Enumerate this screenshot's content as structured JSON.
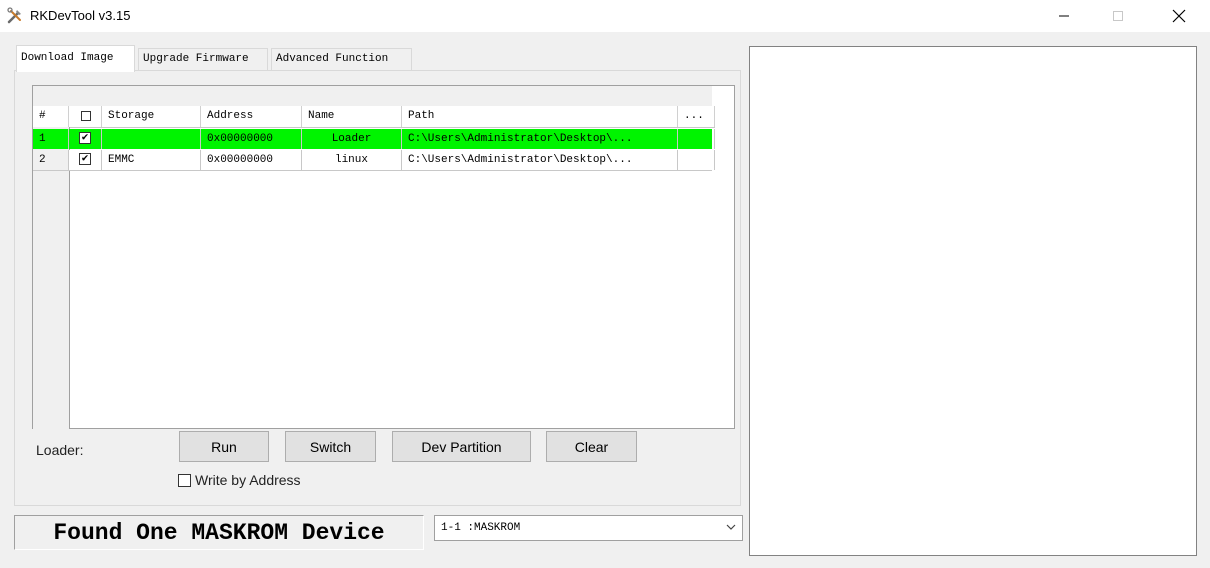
{
  "window": {
    "title": "RKDevTool v3.15"
  },
  "tabs": [
    {
      "label": "Download Image"
    },
    {
      "label": "Upgrade Firmware"
    },
    {
      "label": "Advanced Function"
    }
  ],
  "table": {
    "columns": [
      "#",
      "Storage",
      "Address",
      "Name",
      "Path",
      "..."
    ],
    "rows": [
      {
        "index": "1",
        "checked": "✔",
        "storage": "",
        "address": "0x00000000",
        "name": "Loader",
        "path": "C:\\Users\\Administrator\\Desktop\\..."
      },
      {
        "index": "2",
        "checked": "✔",
        "storage": "EMMC",
        "address": "0x00000000",
        "name": "linux",
        "path": "C:\\Users\\Administrator\\Desktop\\..."
      }
    ]
  },
  "loader_label": "Loader:",
  "buttons": {
    "run": "Run",
    "switch": "Switch",
    "dev_partition": "Dev Partition",
    "clear": "Clear"
  },
  "write_by_address": "Write by Address",
  "status": "Found One MASKROM Device",
  "device": {
    "selected": "1-1 :MASKROM"
  },
  "colors": {
    "highlight_row": "#00f400"
  }
}
